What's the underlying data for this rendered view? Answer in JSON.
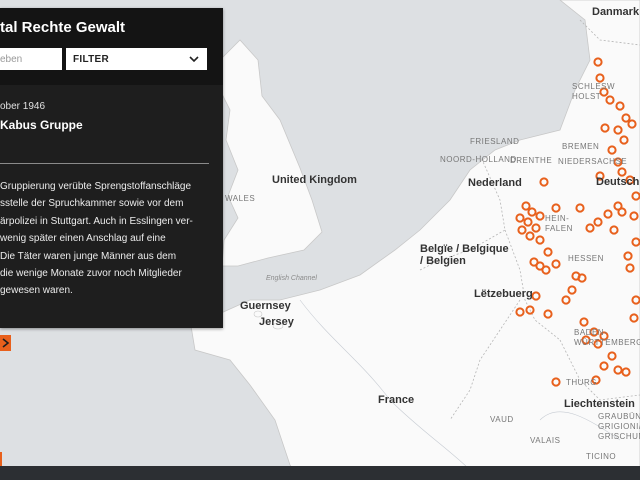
{
  "panel": {
    "title": "tal Rechte Gewalt",
    "search_placeholder": "eben",
    "filter_label": "FILTER",
    "event_date": "ober 1946",
    "event_group": "Kabus Gruppe",
    "description_lines": [
      "Gruppierung verübte Sprengstoffanschläge",
      "sstelle der Spruchkammer sowie vor dem",
      "ärpolizei in Stuttgart. Auch in Esslingen ver-",
      "wenig später einen Anschlag auf eine",
      "Die Täter waren junge Männer aus dem",
      "die wenige Monate zuvor noch Mitglieder",
      "gewesen waren."
    ]
  },
  "map": {
    "countries": {
      "uk": "United\nKingdom",
      "netherlands": "Nederland",
      "belgium": "Belgïe / Belgique\n/ Belgien",
      "luxembourg": "Lëtzebuerg",
      "france": "France",
      "liechtenstein": "Liechtenstein",
      "danmark": "Danmark",
      "deutschland": "Deutschl",
      "guernsey": "Guernsey",
      "jersey": "Jersey"
    },
    "regions": {
      "wales": "WALES",
      "schleswig": "SCHLESW\nHOLST",
      "bremen": "BREMEN",
      "niedersachsen": "NIEDERSACHSE",
      "friesland": "FRIESLAND",
      "noord_holland": "NOORD-HOLLAND",
      "drenthe": "DRENTHE",
      "nordrhein": "HEIN-\nFALEN",
      "hessen": "HESSEN",
      "baden": "BADEN-\nWÜRTTEMBERG",
      "thurg": "THURG",
      "graubunden": "GRAUBÜNDEN/\nGRIGIONI/\nGRISCHUN",
      "valais": "VALAIS",
      "ticino": "TICINO",
      "vaud": "VAUD"
    },
    "seas": {
      "english_channel": "English Channel"
    },
    "colors": {
      "land": "#fafafa",
      "water": "#dcdfe2",
      "marker": "#e8601c",
      "panel": "#1e1e1e"
    }
  }
}
